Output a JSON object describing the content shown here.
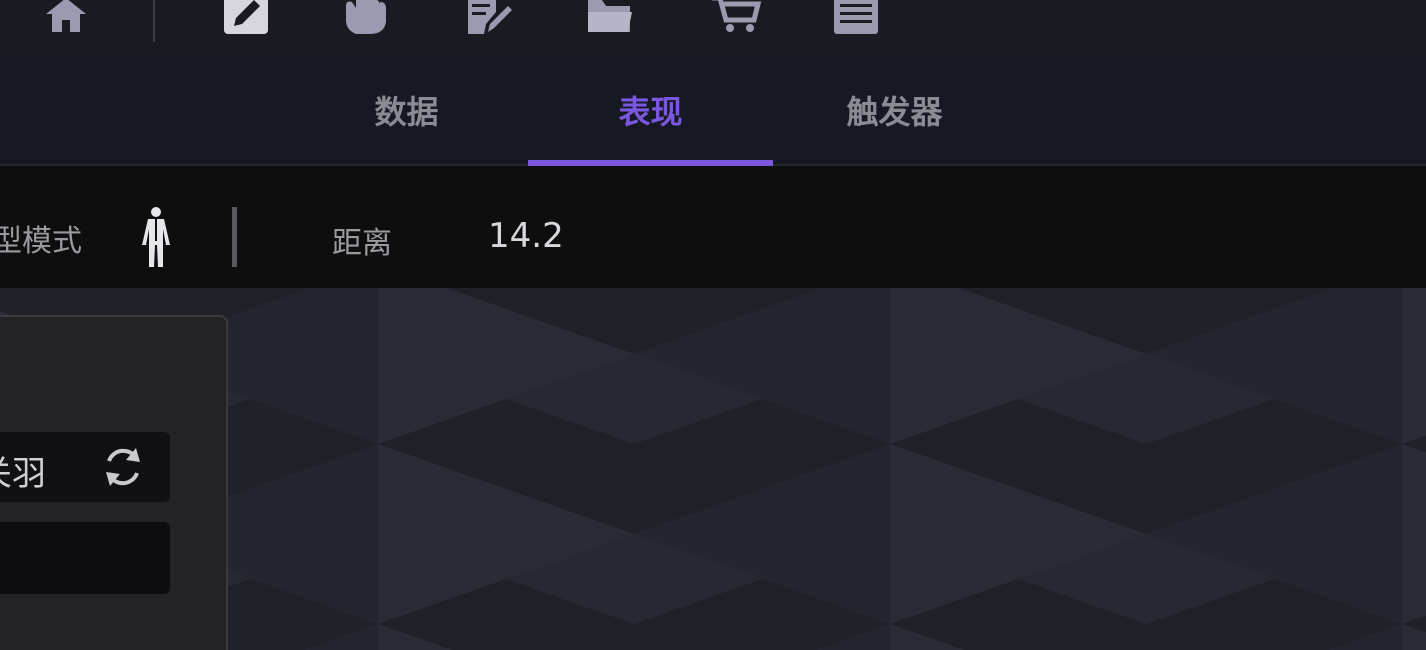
{
  "toolbar": {
    "icons": [
      "home-icon",
      "edit-pencil-icon",
      "hand-icon",
      "document-edit-icon",
      "folder-icon",
      "cart-icon",
      "list-icon"
    ]
  },
  "tabs": [
    {
      "label": "数据",
      "active": false
    },
    {
      "label": "表现",
      "active": true
    },
    {
      "label": "触发器",
      "active": false
    }
  ],
  "modebar": {
    "mode_label": "型模式",
    "distance_label": "距离",
    "distance_value": "14.2"
  },
  "panel": {
    "field1_text": "关羽",
    "field2_text": ""
  },
  "colors": {
    "accent": "#7b57e0",
    "toolbar_bg": "#1a1b22",
    "tabbar_bg": "#161923",
    "modebar_bg": "#0e0e0e",
    "icon": "#9a9bb0"
  }
}
